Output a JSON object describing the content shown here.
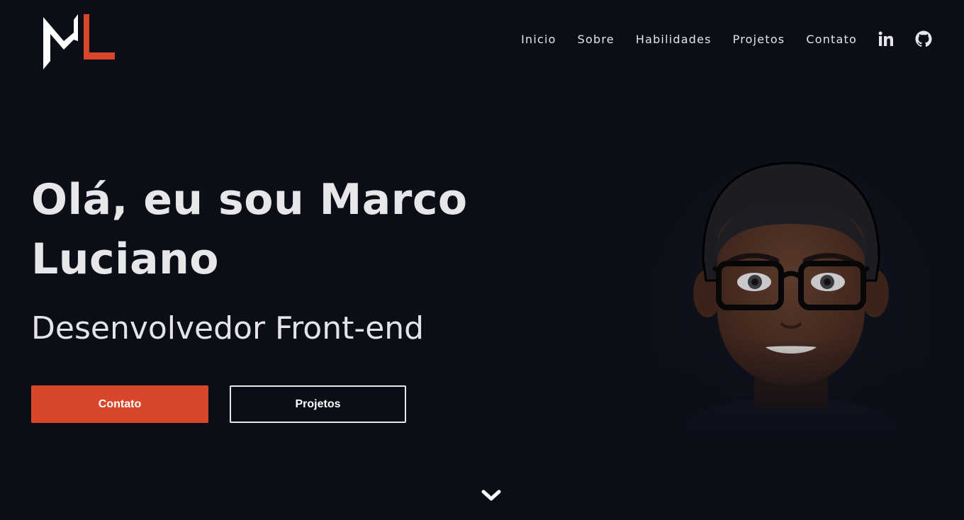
{
  "brand": {
    "logo_text": "ML",
    "accent_color": "#d9472b"
  },
  "nav": {
    "items": [
      {
        "label": "Inicio"
      },
      {
        "label": "Sobre"
      },
      {
        "label": "Habilidades"
      },
      {
        "label": "Projetos"
      },
      {
        "label": "Contato"
      }
    ],
    "social": [
      {
        "icon": "linkedin-icon"
      },
      {
        "icon": "github-icon"
      }
    ]
  },
  "hero": {
    "title_line1": "Olá, eu sou Marco",
    "title_line2": "Luciano",
    "subtitle": "Desenvolvedor Front-end",
    "primary_button": "Contato",
    "secondary_button": "Projetos"
  },
  "avatar": {
    "icon": "avatar-illustration"
  },
  "scroll": {
    "icon": "chevron-down-icon"
  },
  "colors": {
    "background": "#0b0d17",
    "text": "#e7e7ea",
    "accent": "#d9472b"
  }
}
